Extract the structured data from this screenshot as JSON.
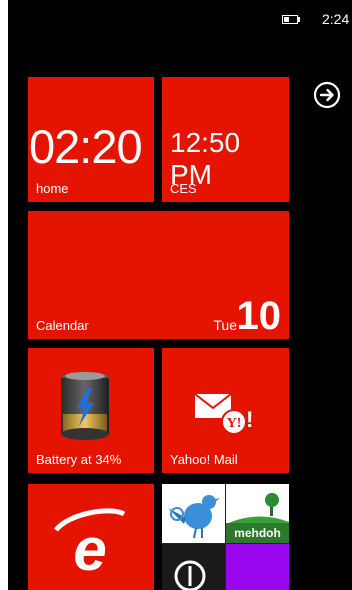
{
  "status": {
    "time": "2:24",
    "battery_icon": "battery-icon"
  },
  "nav": {
    "arrow_icon": "arrow-right-circle-icon"
  },
  "tiles": {
    "clock_home": {
      "time": "02:20",
      "label": "home"
    },
    "clock_ces": {
      "time": "12:50 PM",
      "label": "CES"
    },
    "calendar": {
      "label": "Calendar",
      "day": "Tue",
      "date": "10"
    },
    "battery": {
      "label": "Battery at 34%",
      "percent": 34,
      "icon": "battery-bolt-icon"
    },
    "yahoo_mail": {
      "label": "Yahoo! Mail",
      "icon": "yahoo-mail-icon"
    },
    "internet_explorer": {
      "icon": "internet-explorer-icon"
    },
    "people": {
      "mehdoh_label": "mehdoh"
    }
  },
  "colors": {
    "accent": "#e51400",
    "background": "#000000",
    "purple": "#9a06ee"
  }
}
